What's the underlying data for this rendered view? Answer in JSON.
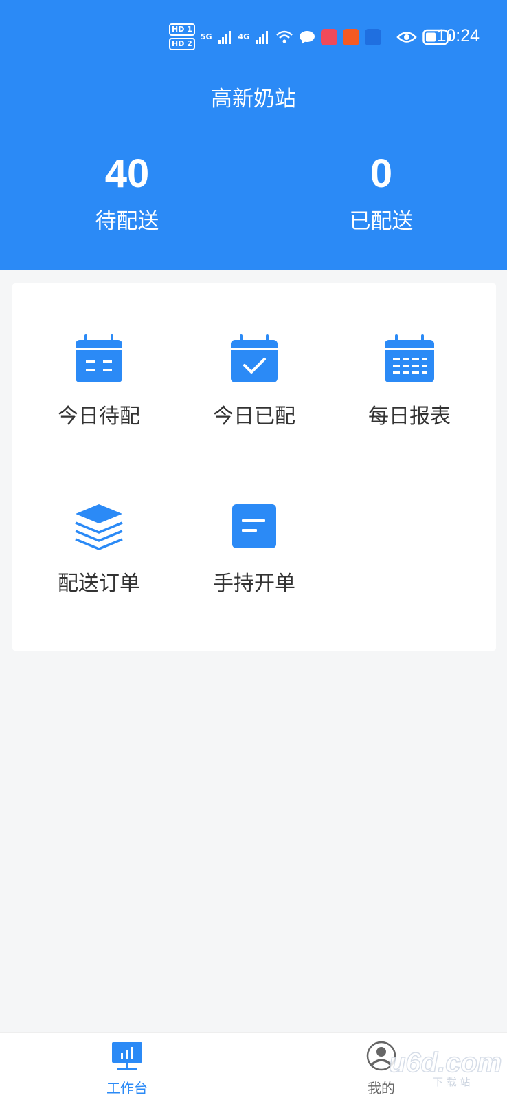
{
  "status_bar": {
    "time": "10:24",
    "hd1": "HD 1",
    "hd2": "HD 2",
    "net1": "5G",
    "net2": "4G"
  },
  "header": {
    "title": "高新奶站",
    "stats": [
      {
        "value": "40",
        "label": "待配送"
      },
      {
        "value": "0",
        "label": "已配送"
      }
    ]
  },
  "menu": {
    "items": [
      {
        "label": "今日待配",
        "icon": "calendar-icon"
      },
      {
        "label": "今日已配",
        "icon": "calendar-check-icon"
      },
      {
        "label": "每日报表",
        "icon": "calendar-grid-icon"
      },
      {
        "label": "配送订单",
        "icon": "layers-icon"
      },
      {
        "label": "手持开单",
        "icon": "note-icon"
      }
    ]
  },
  "tabbar": {
    "tabs": [
      {
        "label": "工作台",
        "icon": "dashboard-icon",
        "active": true
      },
      {
        "label": "我的",
        "icon": "user-icon",
        "active": false
      }
    ]
  },
  "colors": {
    "primary": "#2b8af6",
    "background": "#f5f6f7",
    "text": "#333333",
    "tab_inactive": "#666666"
  }
}
